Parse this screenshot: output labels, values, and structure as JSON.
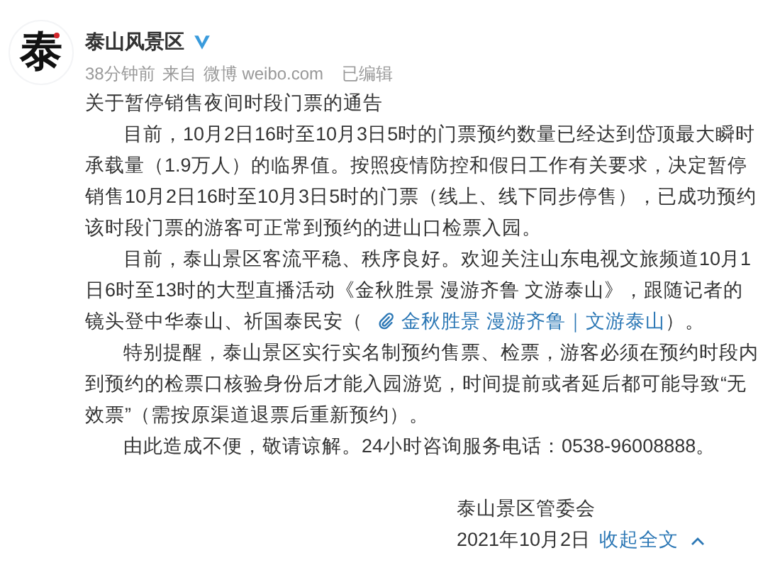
{
  "post": {
    "avatar_text": "泰",
    "author": "泰山风景区",
    "verified": true,
    "time": "38分钟前",
    "source_prefix": "来自",
    "source": "微博 weibo.com",
    "edited": "已编辑",
    "title": "关于暂停销售夜间时段门票的通告",
    "paragraphs": [
      {
        "text": "目前，10月2日16时至10月3日5时的门票预约数量已经达到岱顶最大瞬时承载量（1.9万人）的临界值。按照疫情防控和假日工作有关要求，决定暂停销售10月2日16时至10月3日5时的门票（线上、线下同步停售），已成功预约该时段门票的游客可正常到预约的进山口检票入园。"
      },
      {
        "text": "目前，泰山景区客流平稳、秩序良好。欢迎关注山东电视文旅频道10月1日6时至13时的大型直播活动《金秋胜景 漫游齐鲁 文游泰山》，跟随记者的镜头登中华泰山、祈国泰民安（",
        "link": "金秋胜景 漫游齐鲁｜文游泰山",
        "after": "）。"
      },
      {
        "text": "特别提醒，泰山景区实行实名制预约售票、检票，游客必须在预约时段内到预约的检票口核验身份后才能入园游览，时间提前或者延后都可能导致“无效票”（需按原渠道退票后重新预约）。"
      },
      {
        "text": "由此造成不便，敬请谅解。24小时咨询服务电话：0538-96008888。"
      }
    ],
    "signature": "泰山景区管委会",
    "date": "2021年10月2日",
    "collapse": "收起全文"
  }
}
